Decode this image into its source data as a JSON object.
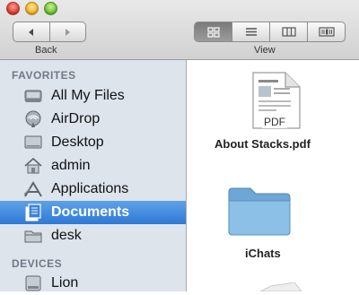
{
  "toolbar": {
    "back_label": "Back",
    "view_label": "View"
  },
  "sidebar": {
    "favorites_header": "FAVORITES",
    "devices_header": "DEVICES",
    "favorites": [
      {
        "label": "All My Files",
        "icon": "all-files-icon"
      },
      {
        "label": "AirDrop",
        "icon": "airdrop-icon"
      },
      {
        "label": "Desktop",
        "icon": "desktop-icon"
      },
      {
        "label": "admin",
        "icon": "home-icon"
      },
      {
        "label": "Applications",
        "icon": "applications-icon"
      },
      {
        "label": "Documents",
        "icon": "documents-icon",
        "selected": true
      },
      {
        "label": "desk",
        "icon": "folder-icon"
      }
    ],
    "devices": [
      {
        "label": "Lion",
        "icon": "drive-icon"
      }
    ]
  },
  "files": [
    {
      "name": "About Stacks.pdf",
      "type": "pdf",
      "badge": "PDF"
    },
    {
      "name": "iChats",
      "type": "folder"
    }
  ],
  "colors": {
    "selection": "#3b82dc",
    "sidebar_bg": "#dde4ec",
    "folder": "#7fb2da"
  }
}
